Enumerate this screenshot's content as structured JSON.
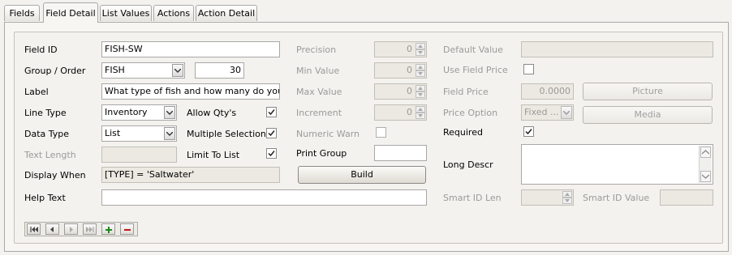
{
  "tabs": [
    {
      "label": "Fields"
    },
    {
      "label": "Field Detail"
    },
    {
      "label": "List Values"
    },
    {
      "label": "Actions"
    },
    {
      "label": "Action Detail"
    }
  ],
  "active_tab": "Field Detail",
  "left": {
    "field_id_label": "Field ID",
    "field_id_value": "FISH-SW",
    "group_order_label": "Group / Order",
    "group_value": "FISH",
    "order_value": "30",
    "label_label": "Label",
    "label_value": "What type of fish and how many do you want",
    "line_type_label": "Line Type",
    "line_type_value": "Inventory",
    "data_type_label": "Data Type",
    "data_type_value": "List",
    "text_length_label": "Text Length",
    "text_length_value": "",
    "display_when_label": "Display When",
    "display_when_value": "[TYPE] = 'Saltwater'",
    "help_text_label": "Help Text",
    "help_text_value": ""
  },
  "middle_checks": {
    "allow_qty_label": "Allow Qty's",
    "allow_qty_checked": true,
    "multiple_selections_label": "Multiple Selections",
    "multiple_selections_checked": true,
    "limit_to_list_label": "Limit To List",
    "limit_to_list_checked": true
  },
  "numeric": {
    "precision_label": "Precision",
    "precision_value": "0",
    "min_value_label": "Min Value",
    "min_value": "0",
    "max_value_label": "Max Value",
    "max_value": "0",
    "increment_label": "Increment",
    "increment_value": "0",
    "numeric_warn_label": "Numeric Warn",
    "numeric_warn_checked": false,
    "print_group_label": "Print Group",
    "print_group_value": "",
    "build_label": "Build"
  },
  "right": {
    "default_value_label": "Default Value",
    "default_value": "",
    "use_field_price_label": "Use Field Price",
    "use_field_price_checked": false,
    "field_price_label": "Field Price",
    "field_price_value": "0.0000",
    "picture_label": "Picture",
    "price_option_label": "Price Option",
    "price_option_value": "Fixed ...",
    "media_label": "Media",
    "required_label": "Required",
    "required_checked": true,
    "long_descr_label": "Long Descr",
    "long_descr_value": "",
    "smart_id_len_label": "Smart ID Len",
    "smart_id_len_value": "",
    "smart_id_value_label": "Smart ID Value",
    "smart_id_value": ""
  },
  "navigator": [
    "first-record-icon",
    "prev-record-icon",
    "next-record-icon",
    "last-record-icon",
    "add-record-icon",
    "delete-record-icon"
  ],
  "colors": {
    "add": "#1a8a1a",
    "delete": "#c81414",
    "disabled_text": "#9a9a9a"
  }
}
